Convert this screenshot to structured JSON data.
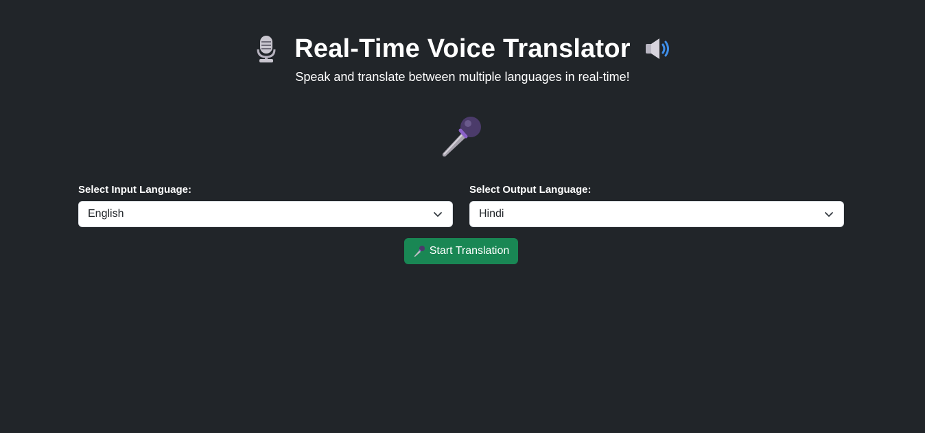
{
  "header": {
    "title": "Real-Time Voice Translator",
    "subtitle": "Speak and translate between multiple languages in real-time!",
    "left_icon": "studio-microphone-icon",
    "right_icon": "speaker-high-volume-icon"
  },
  "hero": {
    "icon": "microphone-icon"
  },
  "input_language": {
    "label": "Select Input Language:",
    "selected": "English"
  },
  "output_language": {
    "label": "Select Output Language:",
    "selected": "Hindi"
  },
  "start_button": {
    "label": "Start Translation",
    "icon": "microphone-icon"
  },
  "colors": {
    "background": "#212529",
    "button": "#198754",
    "text": "#ffffff"
  }
}
